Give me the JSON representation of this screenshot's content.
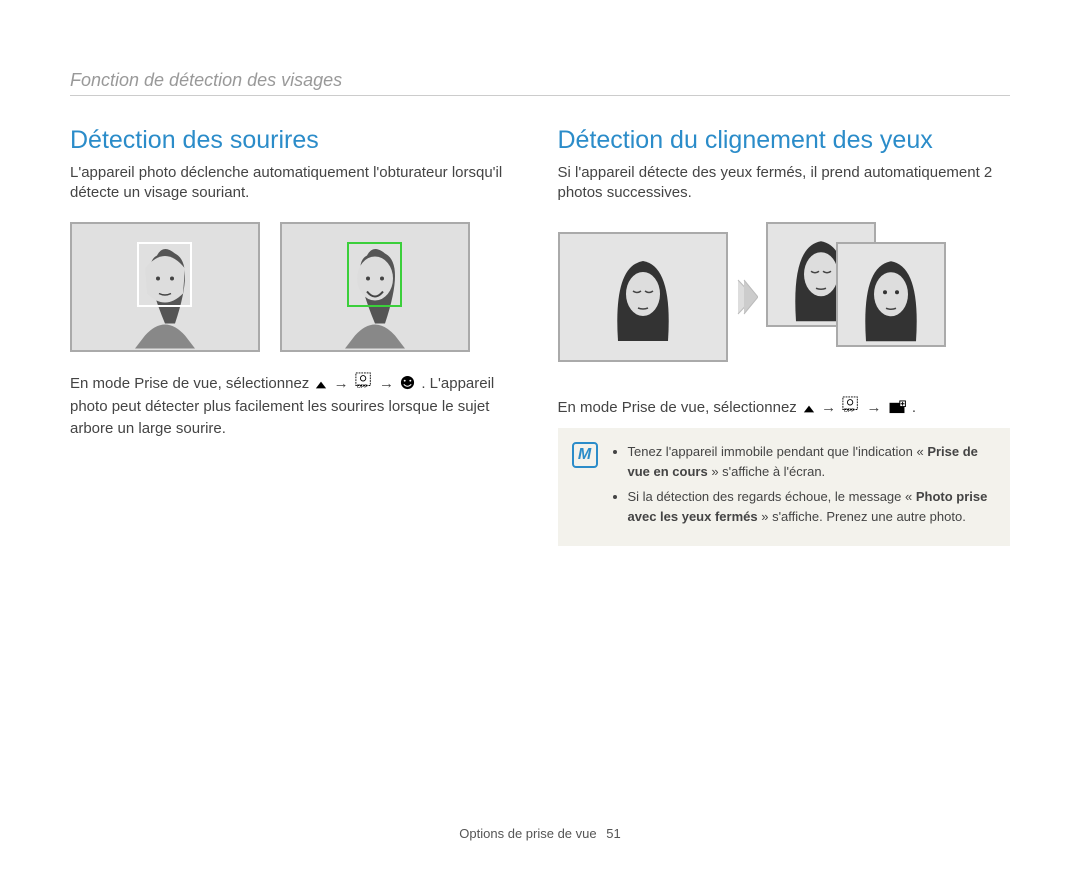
{
  "header": {
    "title": "Fonction de détection des visages"
  },
  "left": {
    "title": "Détection des sourires",
    "intro": "L'appareil photo déclenche automatiquement l'obturateur lorsqu'il détecte un visage souriant.",
    "instr_before": "En mode Prise de vue, sélectionnez ",
    "instr_after": ". L'appareil photo peut détecter plus facilement les sourires lorsque le sujet arbore un large sourire."
  },
  "right": {
    "title": "Détection du clignement des yeux",
    "intro": "Si l'appareil détecte des yeux fermés, il prend automatiquement 2 photos successives.",
    "instr_before": "En mode Prise de vue, sélectionnez ",
    "instr_after": ".",
    "note1_a": "Tenez l'appareil immobile pendant que l'indication « ",
    "note1_bold": "Prise de vue en cours",
    "note1_b": " » s'affiche à l'écran.",
    "note2_a": "Si la détection des regards échoue, le message « ",
    "note2_bold": "Photo prise avec les yeux fermés",
    "note2_b": " » s'affiche. Prenez une autre photo."
  },
  "icons": {
    "arrow": "→",
    "note_label": "M"
  },
  "footer": {
    "chapter": "Options de prise de vue",
    "page": "51"
  }
}
